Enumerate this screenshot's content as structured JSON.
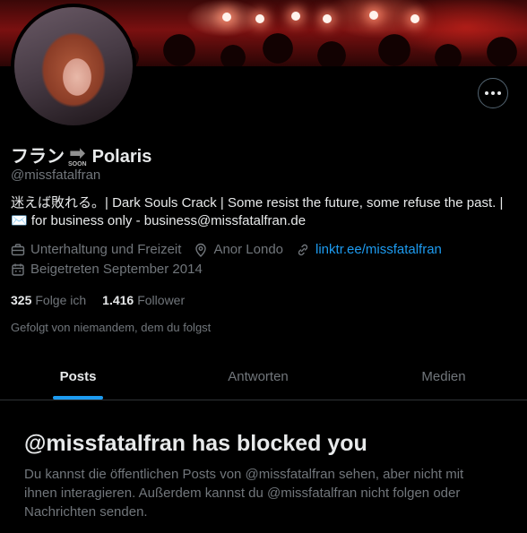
{
  "profile": {
    "name_left": "フラン",
    "soon_tag": "SOON",
    "name_right": "Polaris",
    "handle": "@missfatalfran",
    "bio_line1": "迷えば敗れる。| Dark Souls Crack | Some resist the future, some refuse the past. |",
    "bio_line2_emoji": "✉️",
    "bio_line2": "for business only - business@missfatalfran.de",
    "category": "Unterhaltung und Freizeit",
    "location": "Anor Londo",
    "website": "linktr.ee/missfatalfran",
    "joined": "Beigetreten September 2014",
    "following_count": "325",
    "following_label": "Folge ich",
    "followers_count": "1.416",
    "followers_label": "Follower",
    "followed_by": "Gefolgt von niemandem, dem du folgst"
  },
  "tabs": [
    "Posts",
    "Antworten",
    "Medien"
  ],
  "active_tab": "Posts",
  "blocked": {
    "title": "@missfatalfran has blocked you",
    "message": "Du kannst die öffentlichen Posts von @missfatalfran sehen, aber nicht mit ihnen interagieren. Außerdem kannst du @missfatalfran nicht folgen oder Nachrichten senden."
  },
  "icons": {
    "more": "more-horizontal-icon",
    "category": "briefcase-icon",
    "location": "location-pin-icon",
    "website": "link-icon",
    "joined": "calendar-icon"
  },
  "colors": {
    "accent": "#1d9bf0",
    "muted": "#71767b",
    "text": "#e7e9ea",
    "background": "#000000"
  }
}
